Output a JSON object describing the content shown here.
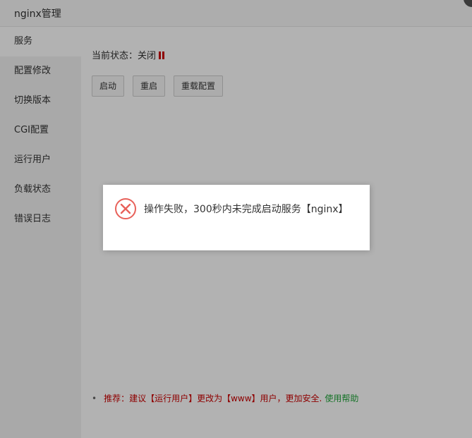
{
  "window": {
    "title": "nginx管理"
  },
  "sidebar": {
    "items": [
      {
        "label": "服务"
      },
      {
        "label": "配置修改"
      },
      {
        "label": "切换版本"
      },
      {
        "label": "CGI配置"
      },
      {
        "label": "运行用户"
      },
      {
        "label": "负载状态"
      },
      {
        "label": "错误日志"
      }
    ]
  },
  "main": {
    "status_text": "当前状态：关闭",
    "status_icon": "pause-icon",
    "status_color": "#cc0000",
    "buttons": {
      "start": "启动",
      "restart": "重启",
      "reload": "重载配置"
    },
    "tip": {
      "bullet": "•",
      "text": "推荐：建议【运行用户】更改为【www】用户，更加安全.",
      "help_link": "使用帮助",
      "text_color": "#cc0000",
      "link_color": "#20a53a"
    }
  },
  "dialog": {
    "icon": "error-icon",
    "message": "操作失败，300秒内未完成启动服务【nginx】"
  }
}
